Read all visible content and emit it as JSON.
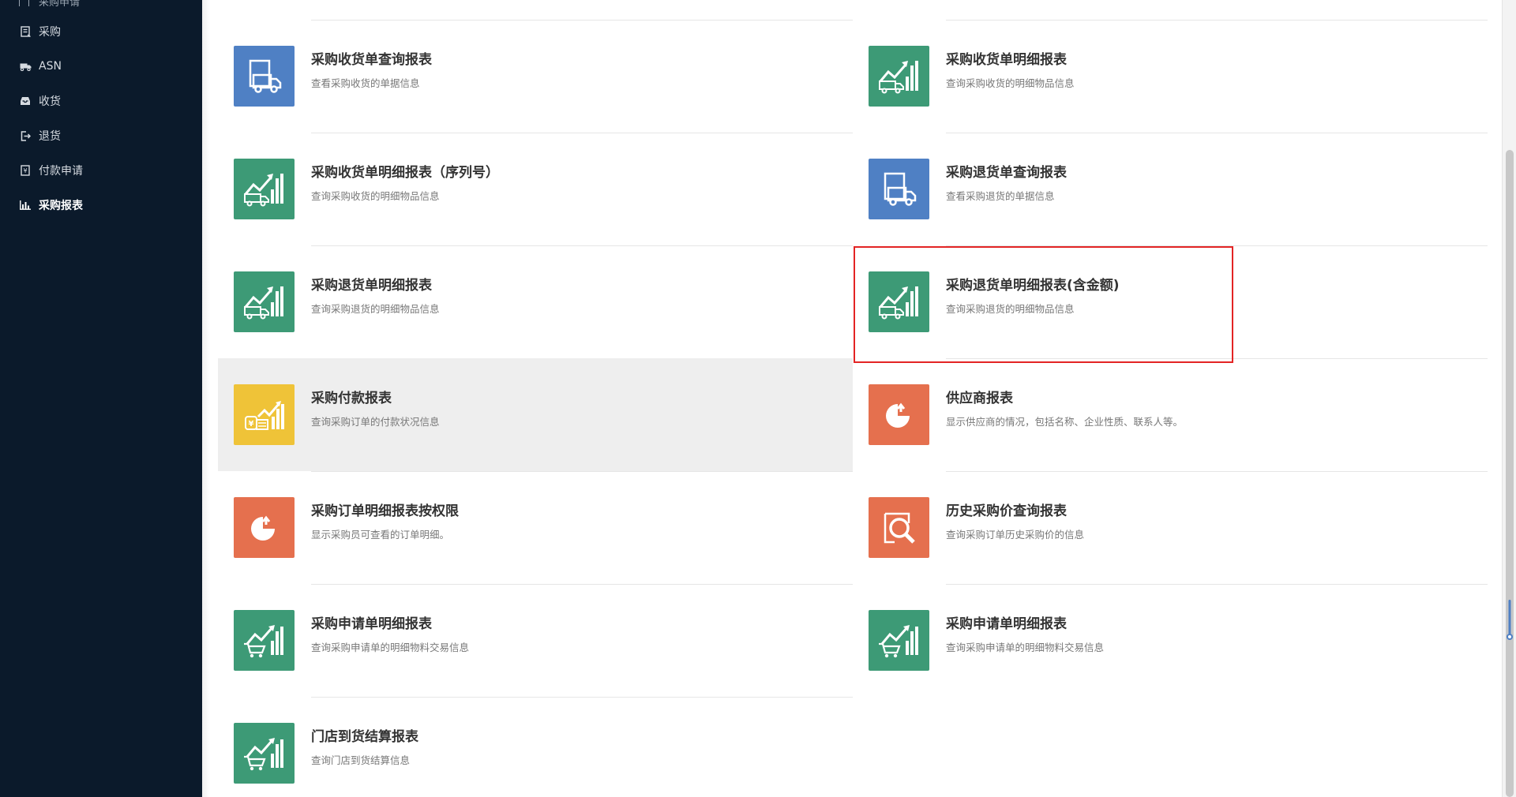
{
  "sidebar": {
    "partial_label": "采购申请",
    "items": [
      {
        "label": "采购",
        "icon": "document-icon"
      },
      {
        "label": "ASN",
        "icon": "truck-icon"
      },
      {
        "label": "收货",
        "icon": "inbox-icon"
      },
      {
        "label": "退货",
        "icon": "return-icon"
      },
      {
        "label": "付款申请",
        "icon": "payment-icon"
      },
      {
        "label": "采购报表",
        "icon": "bar-chart-icon",
        "active": true
      }
    ]
  },
  "reports": [
    {
      "title": "采购收货单查询报表",
      "desc": "查看采购收货的单据信息",
      "icon": "truck-document-icon",
      "color": "#4f80c4"
    },
    {
      "title": "采购收货单明细报表",
      "desc": "查询采购收货的明细物品信息",
      "icon": "truck-chart-icon",
      "color": "#3d9a76"
    },
    {
      "title": "采购收货单明细报表（序列号）",
      "desc": "查询采购收货的明细物品信息",
      "icon": "truck-chart-icon",
      "color": "#3d9a76"
    },
    {
      "title": "采购退货单查询报表",
      "desc": "查看采购退货的单据信息",
      "icon": "truck-document-icon",
      "color": "#4f80c4"
    },
    {
      "title": "采购退货单明细报表",
      "desc": "查询采购退货的明细物品信息",
      "icon": "truck-chart-icon",
      "color": "#3d9a76"
    },
    {
      "title": "采购退货单明细报表(含金额)",
      "desc": "查询采购退货的明细物品信息",
      "icon": "truck-chart-icon",
      "color": "#3d9a76"
    },
    {
      "title": "采购付款报表",
      "desc": "查询采购订单的付款状况信息",
      "icon": "payment-chart-icon",
      "color": "#efc338"
    },
    {
      "title": "供应商报表",
      "desc": "显示供应商的情况，包括名称、企业性质、联系人等。",
      "icon": "pie-chart-icon",
      "color": "#e5704e"
    },
    {
      "title": "采购订单明细报表按权限",
      "desc": "显示采购员可查看的订单明细。",
      "icon": "pie-chart-icon",
      "color": "#e5704e"
    },
    {
      "title": "历史采购价查询报表",
      "desc": "查询采购订单历史采购价的信息",
      "icon": "magnifier-icon",
      "color": "#e5704e"
    },
    {
      "title": "采购申请单明细报表",
      "desc": "查询采购申请单的明细物料交易信息",
      "icon": "cart-chart-icon",
      "color": "#3d9a76"
    },
    {
      "title": "采购申请单明细报表",
      "desc": "查询采购申请单的明细物料交易信息",
      "icon": "cart-chart-icon",
      "color": "#3d9a76"
    },
    {
      "title": "门店到货结算报表",
      "desc": "查询门店到货结算信息",
      "icon": "cart-chart-icon",
      "color": "#3d9a76"
    }
  ]
}
